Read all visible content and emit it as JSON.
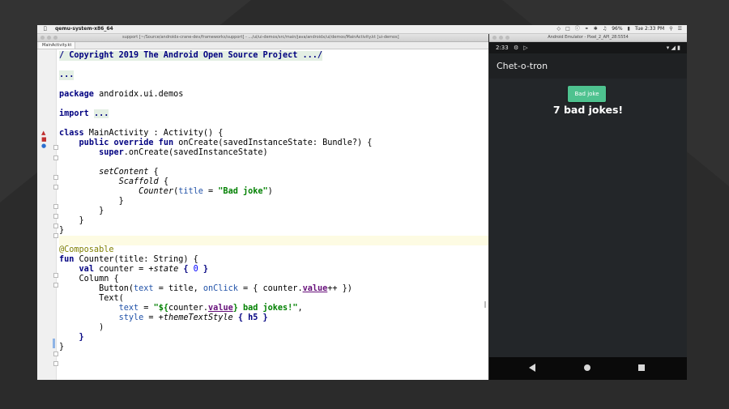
{
  "menubar": {
    "apple": "",
    "app_name": "qemu-system-x86_64",
    "battery": "96%",
    "clock": "Tue 2:33 PM"
  },
  "ide": {
    "window_title": "support [~/Source/androidx-crane-dev/frameworks/support] - .../ui/ui-demos/src/main/java/androidx/ui/demos/MainActivity.kt [ui-demos]",
    "tab": "MainActivity.kt"
  },
  "code": {
    "l1": "/ Copyright 2019 The Android Open Source Project .../",
    "l3": "...",
    "l5_kw": "package",
    "l5_rest": " androidx.ui.demos",
    "l7_kw": "import",
    "l7_rest": "...",
    "l9_kw": "class",
    "l9_rest": " MainActivity : Activity() {",
    "l10_kw": "public override fun",
    "l10_rest": " onCreate(savedInstanceState: Bundle?) {",
    "l11_kw": "super",
    "l11_rest": ".onCreate(savedInstanceState)",
    "l13_fn": "setContent",
    "l13_rest": " {",
    "l14_fn": "Scaffold",
    "l14_rest": " {",
    "l15_fn": "Counter",
    "l15_open": "(",
    "l15_param": "title",
    "l15_eq": " = ",
    "l15_str": "\"Bad joke\"",
    "l15_close": ")",
    "l16": "}",
    "l17": "}",
    "l18": "}",
    "l19": "}",
    "l21": "@Composable",
    "l22_kw": "fun",
    "l22_rest": " Counter(title: String) {",
    "l23_kw": "val",
    "l23_a": " counter = +",
    "l23_fn": "state",
    "l23_b": " { ",
    "l23_num": "0",
    "l23_c": " }",
    "l24": "Column {",
    "l25_a": "Button(",
    "l25_p1": "text",
    "l25_b": " = title, ",
    "l25_p2": "onClick",
    "l25_c": " = { counter.",
    "l25_ref": "value",
    "l25_d": "++ })",
    "l26": "Text(",
    "l27_p": "text",
    "l27_a": " = ",
    "l27_s1": "\"${",
    "l27_b": "counter.",
    "l27_ref": "value",
    "l27_s2": "} bad jokes!\"",
    "l27_c": ",",
    "l28_p": "style",
    "l28_a": " = +",
    "l28_fn": "themeTextStyle",
    "l28_b": " { ",
    "l28_kw": "h5",
    "l28_c": " }",
    "l29": ")",
    "l30": "}",
    "l31": "}"
  },
  "emulator": {
    "window_title": "Android Emulator - Pixel_2_API_28:5554",
    "status_time": "2:33",
    "app_title": "Chet-o-tron",
    "button_label": "Bad joke",
    "count_text": "7 bad jokes!"
  },
  "colors": {
    "button": "#4ec28f",
    "app_bg": "#232629",
    "keyword": "#000080",
    "string": "#008000"
  }
}
